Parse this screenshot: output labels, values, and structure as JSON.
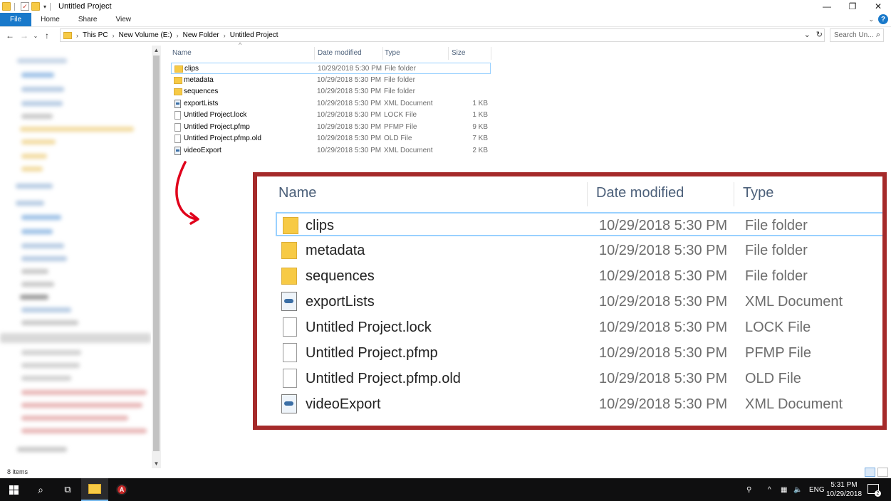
{
  "window": {
    "title": "Untitled Project",
    "controls": [
      "—",
      "❐",
      "✕"
    ]
  },
  "ribbon": {
    "tabs": [
      "File",
      "Home",
      "Share",
      "View"
    ]
  },
  "address": {
    "crumbs": [
      "This PC",
      "New Volume (E:)",
      "New Folder",
      "Untitled Project"
    ]
  },
  "search": {
    "placeholder": "Search Un..."
  },
  "columns": {
    "name": "Name",
    "date": "Date modified",
    "type": "Type",
    "size": "Size"
  },
  "files": [
    {
      "name": "clips",
      "date": "10/29/2018 5:30 PM",
      "type": "File folder",
      "size": "",
      "icon": "folder"
    },
    {
      "name": "metadata",
      "date": "10/29/2018 5:30 PM",
      "type": "File folder",
      "size": "",
      "icon": "folder"
    },
    {
      "name": "sequences",
      "date": "10/29/2018 5:30 PM",
      "type": "File folder",
      "size": "",
      "icon": "folder"
    },
    {
      "name": "exportLists",
      "date": "10/29/2018 5:30 PM",
      "type": "XML Document",
      "size": "1 KB",
      "icon": "xml"
    },
    {
      "name": "Untitled Project.lock",
      "date": "10/29/2018 5:30 PM",
      "type": "LOCK File",
      "size": "1 KB",
      "icon": "doc"
    },
    {
      "name": "Untitled Project.pfmp",
      "date": "10/29/2018 5:30 PM",
      "type": "PFMP File",
      "size": "9 KB",
      "icon": "doc"
    },
    {
      "name": "Untitled Project.pfmp.old",
      "date": "10/29/2018 5:30 PM",
      "type": "OLD File",
      "size": "7 KB",
      "icon": "doc"
    },
    {
      "name": "videoExport",
      "date": "10/29/2018 5:30 PM",
      "type": "XML Document",
      "size": "2 KB",
      "icon": "xml"
    }
  ],
  "status": {
    "items": "8 items"
  },
  "taskbar": {
    "lang": "ENG",
    "time": "5:31 PM",
    "date": "10/29/2018",
    "notifications": "2"
  },
  "colors": {
    "accent": "#1979ca",
    "callout_border": "#a52a2a",
    "arrow": "#e0001b",
    "folder": "#f7ca45"
  }
}
